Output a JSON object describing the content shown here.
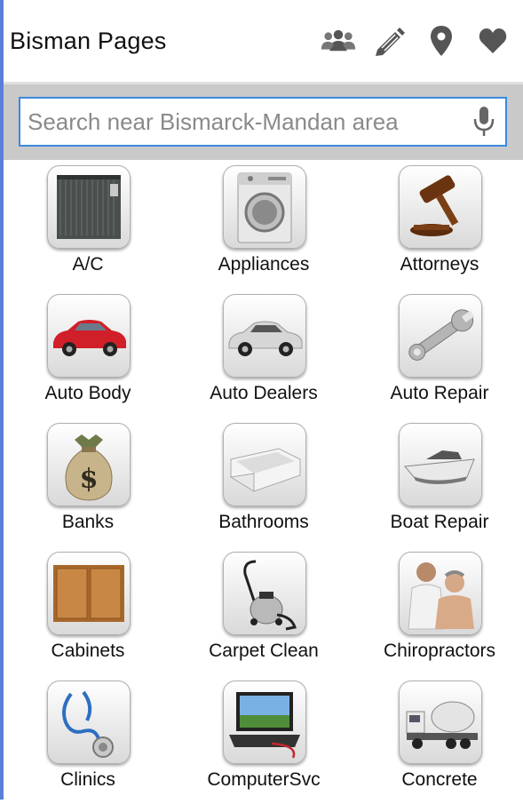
{
  "header": {
    "title": "Bisman Pages",
    "icons": [
      "people-icon",
      "pencil-icon",
      "location-pin-icon",
      "heart-icon"
    ]
  },
  "search": {
    "placeholder": "Search near Bismarck-Mandan area",
    "value": ""
  },
  "categories": [
    {
      "label": "A/C",
      "icon": "air-conditioner-icon"
    },
    {
      "label": "Appliances",
      "icon": "washing-machine-icon"
    },
    {
      "label": "Attorneys",
      "icon": "gavel-icon"
    },
    {
      "label": "Auto Body",
      "icon": "red-car-icon"
    },
    {
      "label": "Auto Dealers",
      "icon": "silver-car-icon"
    },
    {
      "label": "Auto Repair",
      "icon": "wrench-icon"
    },
    {
      "label": "Banks",
      "icon": "money-bag-icon"
    },
    {
      "label": "Bathrooms",
      "icon": "bathtub-icon"
    },
    {
      "label": "Boat Repair",
      "icon": "boat-icon"
    },
    {
      "label": "Cabinets",
      "icon": "cabinet-icon"
    },
    {
      "label": "Carpet Clean",
      "icon": "vacuum-icon"
    },
    {
      "label": "Chiropractors",
      "icon": "chiropractor-icon"
    },
    {
      "label": "Clinics",
      "icon": "stethoscope-icon"
    },
    {
      "label": "ComputerSvc",
      "icon": "laptop-icon"
    },
    {
      "label": "Concrete",
      "icon": "cement-truck-icon"
    }
  ],
  "colors": {
    "accent": "#3a8ae0",
    "search_band": "#c9c9c9",
    "left_edge": "#5b7fd6",
    "icon_gray": "#555555"
  }
}
